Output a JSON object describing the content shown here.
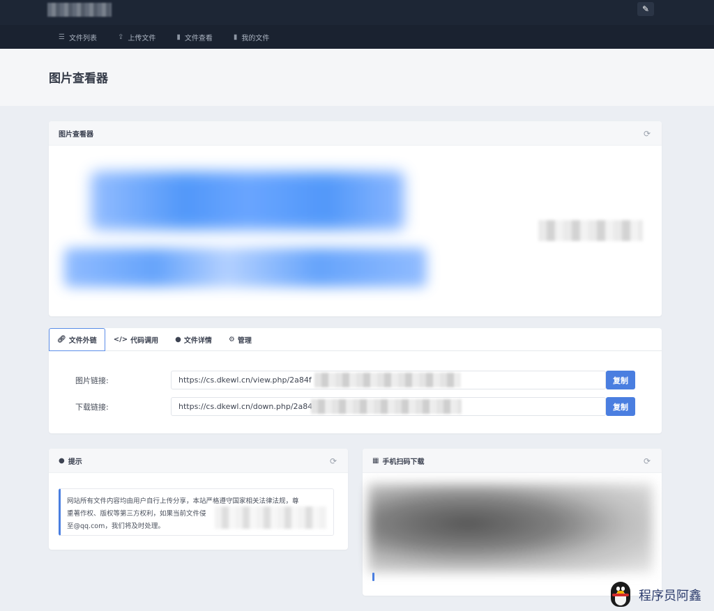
{
  "header": {
    "edit_icon": "brush-icon"
  },
  "nav": {
    "items": [
      {
        "label": "文件列表",
        "icon": "list-icon"
      },
      {
        "label": "上传文件",
        "icon": "upload-icon"
      },
      {
        "label": "文件查看",
        "icon": "file-icon"
      },
      {
        "label": "我的文件",
        "icon": "file-icon"
      }
    ]
  },
  "page": {
    "title": "图片查看器"
  },
  "viewer": {
    "title": "图片查看器",
    "refresh_icon": "refresh-icon"
  },
  "links": {
    "tabs": [
      {
        "label": "文件外链",
        "icon": "link-icon",
        "active": true
      },
      {
        "label": "代码调用",
        "icon": "code-icon",
        "active": false
      },
      {
        "label": "文件详情",
        "icon": "info-icon",
        "active": false
      },
      {
        "label": "管理",
        "icon": "gear-icon",
        "active": false
      }
    ],
    "rows": [
      {
        "label": "图片链接:",
        "value": "https://cs.dkewl.cn/view.php/2a84f",
        "button": "复制"
      },
      {
        "label": "下载链接:",
        "value": "https://cs.dkewl.cn/down.php/2a84",
        "button": "复制"
      }
    ]
  },
  "notice": {
    "title": "提示",
    "icon": "exclamation-circle-icon",
    "line1": "网站所有文件内容均由用户自行上传分享，本站严格遵守国家相关法律法规，尊",
    "line2": "重著作权、版权等第三方权利，如果当前文件侵",
    "line3": "至@qq.com，我们将及时处理。"
  },
  "qr": {
    "title": "手机扫码下载",
    "icon": "qrcode-icon"
  },
  "watermark": {
    "text": "程序员阿鑫"
  },
  "colors": {
    "topbar": "#1d2635",
    "navbar": "#1a2230",
    "accent": "#4a7ee0",
    "page_bg": "#ebeef3"
  }
}
